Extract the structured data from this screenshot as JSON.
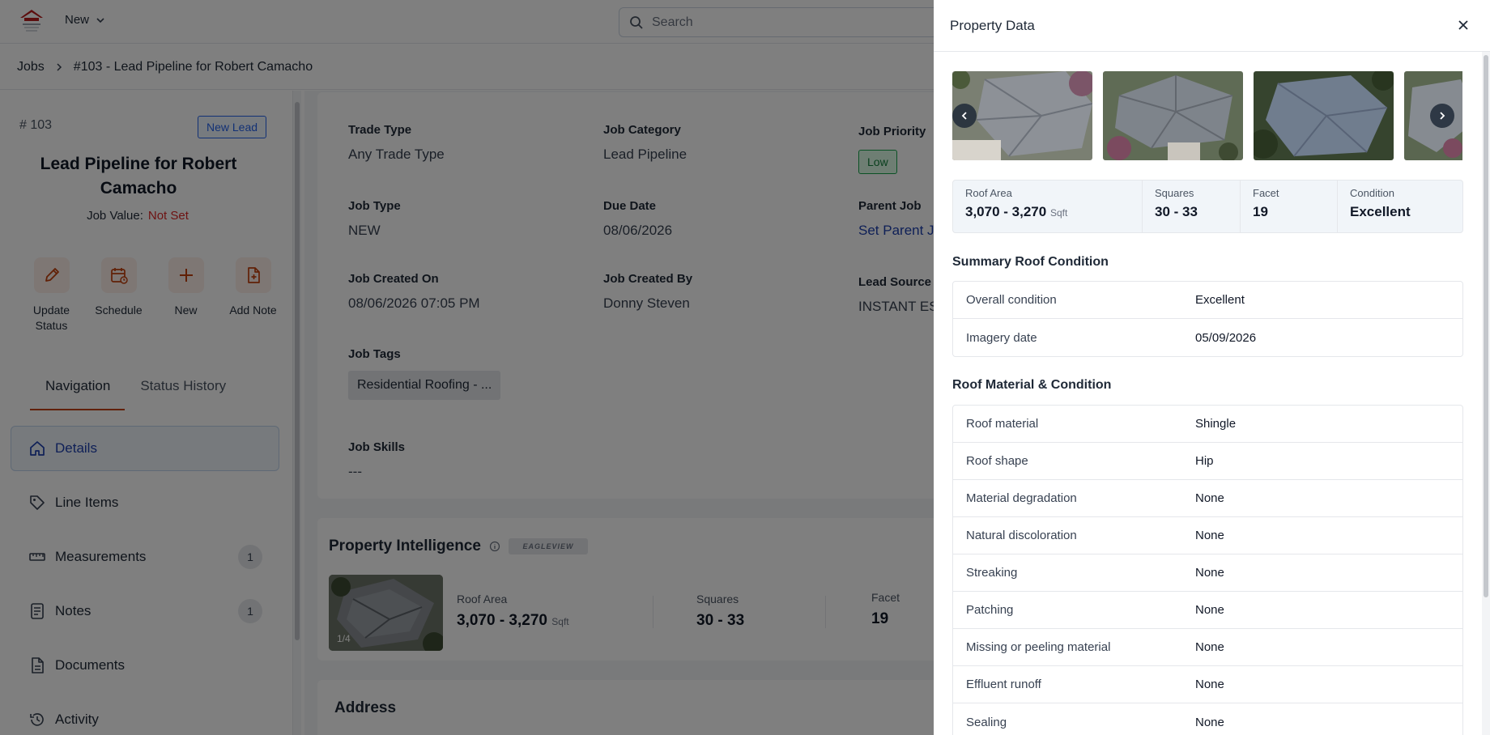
{
  "topbar": {
    "new_label": "New",
    "search_placeholder": "Search"
  },
  "breadcrumb": {
    "root": "Jobs",
    "current": "#103 - Lead Pipeline for Robert Camacho"
  },
  "job": {
    "number": "# 103",
    "status_badge": "New Lead",
    "title": "Lead Pipeline for Robert Camacho",
    "value_label": "Job Value:",
    "value": "Not Set"
  },
  "actions": [
    {
      "label": "Update Status",
      "icon": "pencil-icon"
    },
    {
      "label": "Schedule",
      "icon": "calendar-icon"
    },
    {
      "label": "New",
      "icon": "plus-icon"
    },
    {
      "label": "Add Note",
      "icon": "note-add-icon"
    }
  ],
  "nav_tabs": [
    "Navigation",
    "Status History"
  ],
  "nav_items": [
    {
      "label": "Details",
      "icon": "home-icon",
      "count": ""
    },
    {
      "label": "Line Items",
      "icon": "tag-icon",
      "count": ""
    },
    {
      "label": "Measurements",
      "icon": "ruler-icon",
      "count": "1"
    },
    {
      "label": "Notes",
      "icon": "notes-icon",
      "count": "1"
    },
    {
      "label": "Documents",
      "icon": "document-icon",
      "count": ""
    },
    {
      "label": "Activity",
      "icon": "history-icon",
      "count": ""
    }
  ],
  "details": {
    "trade_type": {
      "label": "Trade Type",
      "value": "Any Trade Type"
    },
    "job_category": {
      "label": "Job Category",
      "value": "Lead Pipeline"
    },
    "job_priority": {
      "label": "Job Priority",
      "value": "Low"
    },
    "job_type": {
      "label": "Job Type",
      "value": "NEW"
    },
    "due_date": {
      "label": "Due Date",
      "value": "08/06/2026"
    },
    "parent_job": {
      "label": "Parent Job",
      "value": "Set Parent Job"
    },
    "created_on": {
      "label": "Job Created On",
      "value": "08/06/2026 07:05 PM"
    },
    "created_by": {
      "label": "Job Created By",
      "value": "Donny Steven"
    },
    "lead_source": {
      "label": "Lead Source",
      "value": "INSTANT ESTI"
    },
    "job_tags": {
      "label": "Job Tags",
      "value": "Residential Roofing - ..."
    },
    "job_skills": {
      "label": "Job Skills",
      "value": "---"
    }
  },
  "property_intelligence": {
    "title": "Property Intelligence",
    "provider": "EAGLEVIEW",
    "image_counter": "1/4",
    "roof_area": {
      "label": "Roof Area",
      "value": "3,070 - 3,270",
      "unit": "Sqft"
    },
    "squares": {
      "label": "Squares",
      "value": "30 - 33"
    },
    "facet": {
      "label": "Facet",
      "value": "19"
    }
  },
  "address": {
    "title": "Address"
  },
  "drawer": {
    "title": "Property Data",
    "stats": {
      "roof_area": {
        "label": "Roof Area",
        "value": "3,070 - 3,270",
        "unit": "Sqft"
      },
      "squares": {
        "label": "Squares",
        "value": "30 - 33"
      },
      "facet": {
        "label": "Facet",
        "value": "19"
      },
      "condition": {
        "label": "Condition",
        "value": "Excellent"
      }
    },
    "summary_title": "Summary Roof Condition",
    "summary": [
      {
        "key": "Overall condition",
        "value": "Excellent"
      },
      {
        "key": "Imagery date",
        "value": "05/09/2026"
      }
    ],
    "material_title": "Roof Material & Condition",
    "material": [
      {
        "key": "Roof material",
        "value": "Shingle"
      },
      {
        "key": "Roof shape",
        "value": "Hip"
      },
      {
        "key": "Material degradation",
        "value": "None"
      },
      {
        "key": "Natural discoloration",
        "value": "None"
      },
      {
        "key": "Streaking",
        "value": "None"
      },
      {
        "key": "Patching",
        "value": "None"
      },
      {
        "key": "Missing or peeling material",
        "value": "None"
      },
      {
        "key": "Effluent runoff",
        "value": "None"
      },
      {
        "key": "Sealing",
        "value": "None"
      }
    ]
  },
  "colors": {
    "accent": "#c2410c",
    "link": "#1e40af",
    "not_set": "#dc2626",
    "priority_low": "#16a34a"
  }
}
